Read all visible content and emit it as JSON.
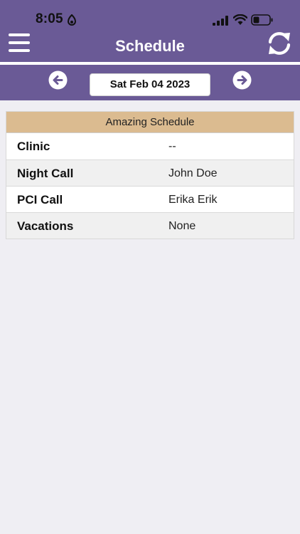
{
  "status": {
    "time": "8:05"
  },
  "header": {
    "title": "Schedule"
  },
  "date_nav": {
    "date": "Sat Feb 04 2023"
  },
  "schedule": {
    "title": "Amazing Schedule",
    "rows": [
      {
        "label": "Clinic",
        "value": "--"
      },
      {
        "label": "Night Call",
        "value": "John Doe"
      },
      {
        "label": "PCI Call",
        "value": "Erika Erik"
      },
      {
        "label": "Vacations",
        "value": "None"
      }
    ]
  },
  "colors": {
    "header_bg": "#6a5a96",
    "table_header_bg": "#dbbb90",
    "page_bg": "#efeef3"
  }
}
